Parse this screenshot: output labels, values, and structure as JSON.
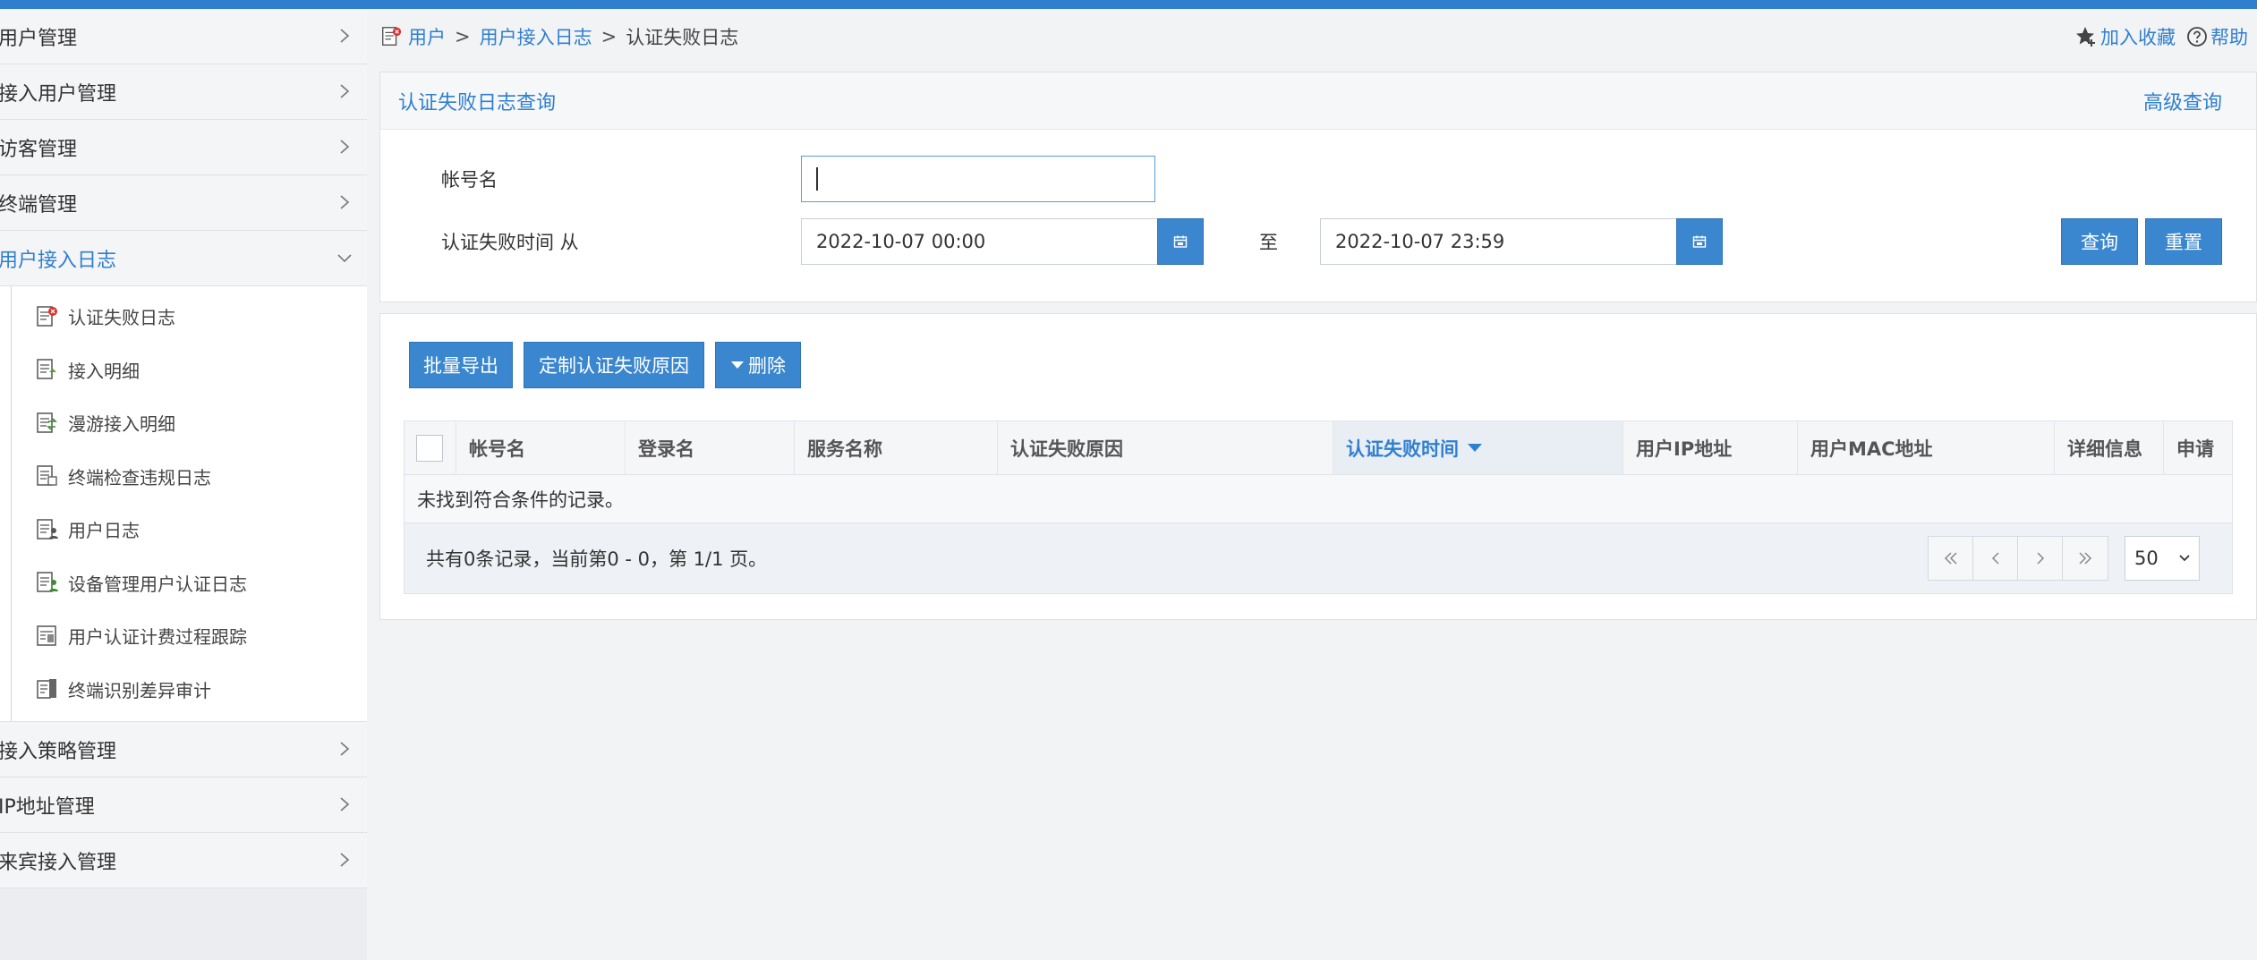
{
  "sidebar": {
    "top_items": [
      {
        "label": "用户管理"
      },
      {
        "label": "接入用户管理"
      },
      {
        "label": "访客管理"
      },
      {
        "label": "终端管理"
      },
      {
        "label": "用户接入日志"
      }
    ],
    "sub_items": [
      {
        "label": "认证失败日志"
      },
      {
        "label": "接入明细"
      },
      {
        "label": "漫游接入明细"
      },
      {
        "label": "终端检查违规日志"
      },
      {
        "label": "用户日志"
      },
      {
        "label": "设备管理用户认证日志"
      },
      {
        "label": "用户认证计费过程跟踪"
      },
      {
        "label": "终端识别差异审计"
      }
    ],
    "bottom_items": [
      {
        "label": "接入策略管理"
      },
      {
        "label": "IP地址管理"
      },
      {
        "label": "来宾接入管理"
      }
    ]
  },
  "breadcrumb": {
    "items": [
      "用户",
      "用户接入日志",
      "认证失败日志"
    ],
    "sep": ">"
  },
  "top_actions": {
    "favorite": "加入收藏",
    "help": "帮助"
  },
  "query_panel": {
    "title": "认证失败日志查询",
    "advanced": "高级查询",
    "account_label": "帐号名",
    "account_value": "",
    "time_label": "认证失败时间 从",
    "time_from": "2022-10-07 00:00",
    "to_label": "至",
    "time_to": "2022-10-07 23:59",
    "query_button": "查询",
    "reset_button": "重置"
  },
  "toolbar": {
    "export_button": "批量导出",
    "custom_reason_button": "定制认证失败原因",
    "delete_button": "删除"
  },
  "table": {
    "columns": [
      "帐号名",
      "登录名",
      "服务名称",
      "认证失败原因",
      "认证失败时间",
      "用户IP地址",
      "用户MAC地址",
      "详细信息",
      "申请"
    ],
    "sorted_column": "认证失败时间",
    "empty_text": "未找到符合条件的记录。"
  },
  "pager": {
    "summary": "共有0条记录，当前第0 - 0，第 1/1 页。",
    "page_size": "50"
  },
  "colors": {
    "accent": "#2f7fcf",
    "button": "#3a87cf"
  }
}
